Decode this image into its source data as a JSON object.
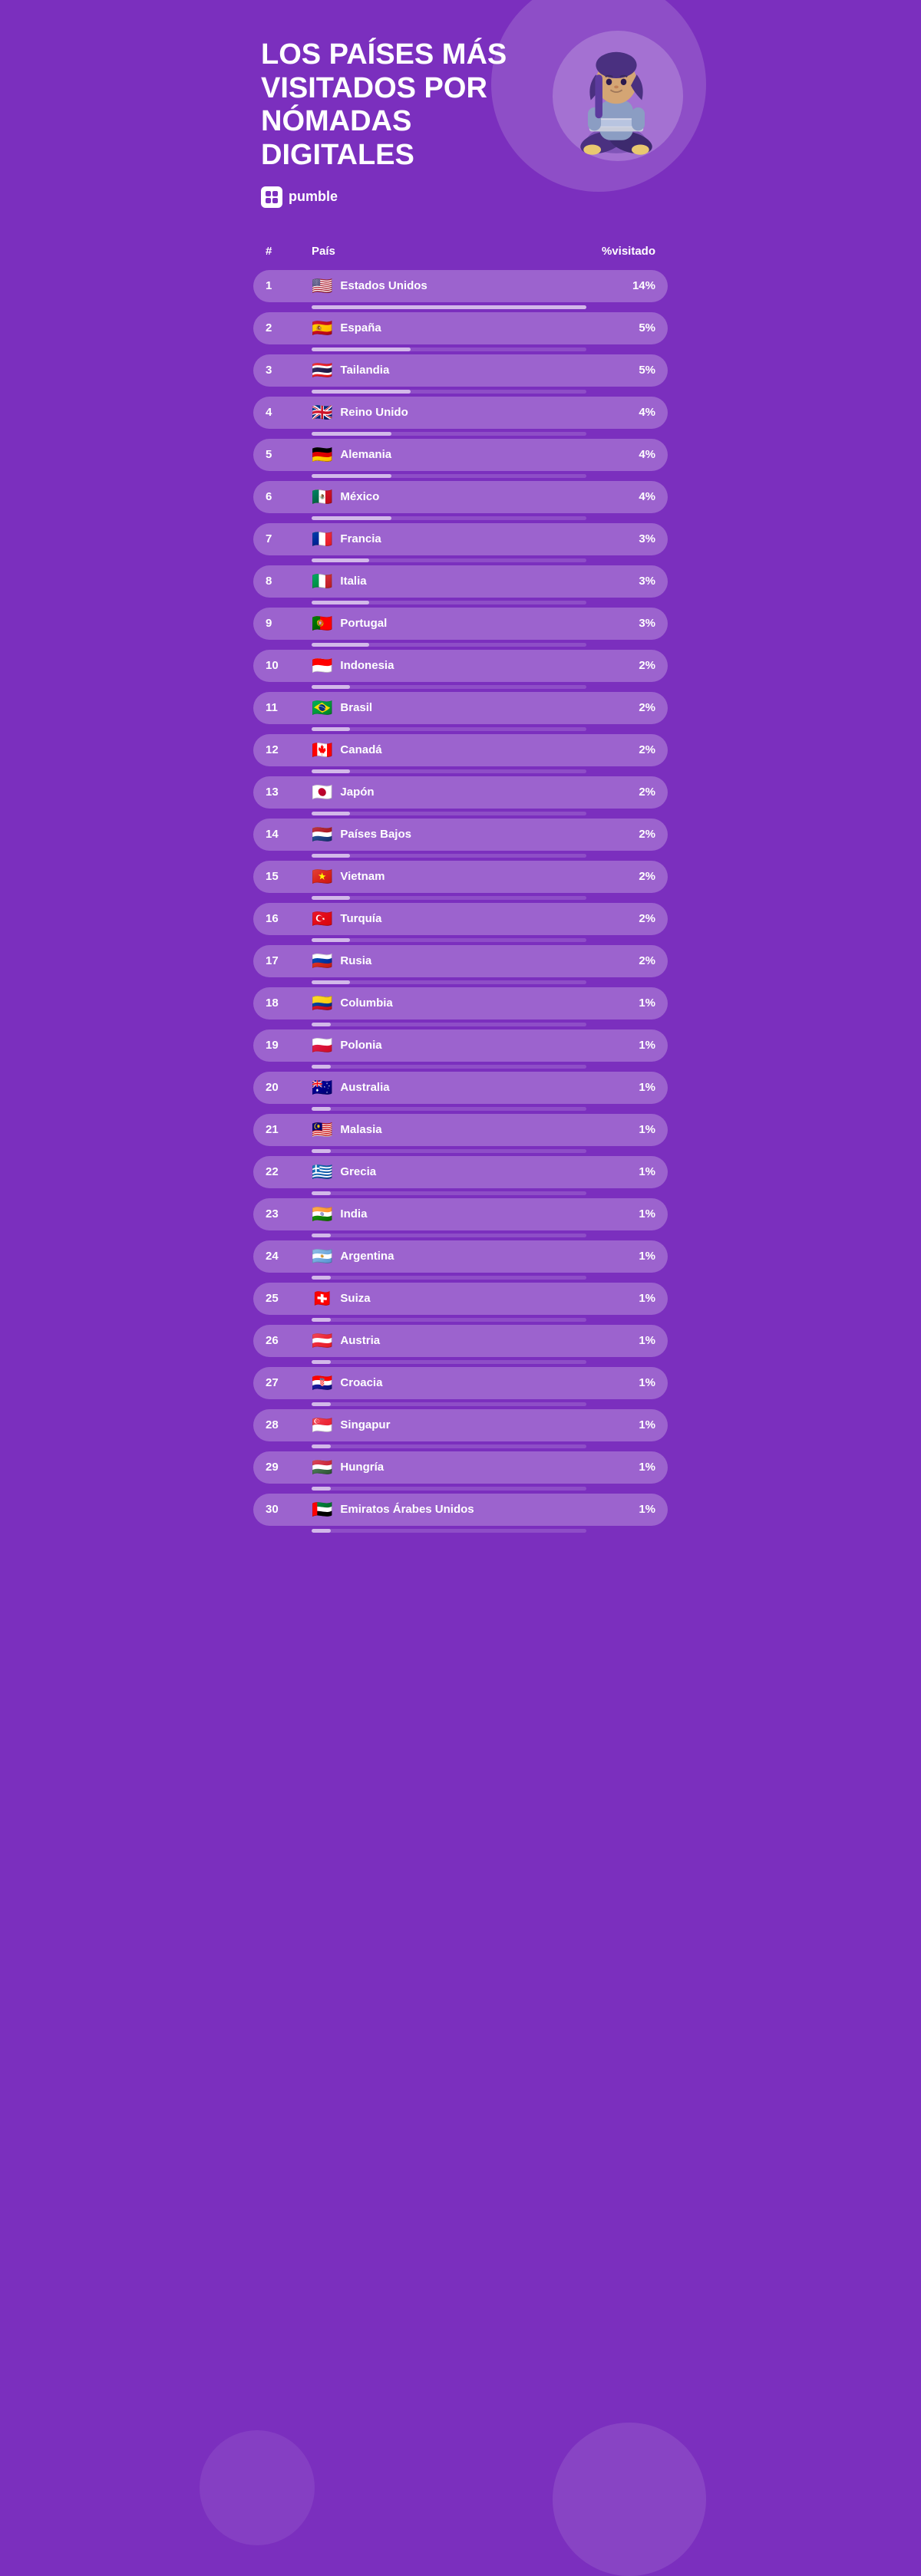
{
  "header": {
    "title": "LOS PAÍSES MÁS VISITADOS POR NÓMADAS DIGITALES",
    "logo_text": "pumble",
    "logo_icon": "🔲"
  },
  "table": {
    "columns": [
      "#",
      "País",
      "%visitado"
    ],
    "rows": [
      {
        "rank": "1",
        "country": "Estados Unidos",
        "flag": "🇺🇸",
        "percent": "14%",
        "bar": 100
      },
      {
        "rank": "2",
        "country": "España",
        "flag": "🇪🇸",
        "percent": "5%",
        "bar": 36
      },
      {
        "rank": "3",
        "country": "Tailandia",
        "flag": "🇹🇭",
        "percent": "5%",
        "bar": 36
      },
      {
        "rank": "4",
        "country": "Reino Unido",
        "flag": "🇬🇧",
        "percent": "4%",
        "bar": 29
      },
      {
        "rank": "5",
        "country": "Alemania",
        "flag": "🇩🇪",
        "percent": "4%",
        "bar": 29
      },
      {
        "rank": "6",
        "country": "México",
        "flag": "🇲🇽",
        "percent": "4%",
        "bar": 29
      },
      {
        "rank": "7",
        "country": "Francia",
        "flag": "🇫🇷",
        "percent": "3%",
        "bar": 21
      },
      {
        "rank": "8",
        "country": "Italia",
        "flag": "🇮🇹",
        "percent": "3%",
        "bar": 21
      },
      {
        "rank": "9",
        "country": "Portugal",
        "flag": "🇵🇹",
        "percent": "3%",
        "bar": 21
      },
      {
        "rank": "10",
        "country": "Indonesia",
        "flag": "🇮🇩",
        "percent": "2%",
        "bar": 14
      },
      {
        "rank": "11",
        "country": "Brasil",
        "flag": "🇧🇷",
        "percent": "2%",
        "bar": 14
      },
      {
        "rank": "12",
        "country": "Canadá",
        "flag": "🇨🇦",
        "percent": "2%",
        "bar": 14
      },
      {
        "rank": "13",
        "country": "Japón",
        "flag": "🇯🇵",
        "percent": "2%",
        "bar": 14
      },
      {
        "rank": "14",
        "country": "Países Bajos",
        "flag": "🇳🇱",
        "percent": "2%",
        "bar": 14
      },
      {
        "rank": "15",
        "country": "Vietnam",
        "flag": "🇻🇳",
        "percent": "2%",
        "bar": 14
      },
      {
        "rank": "16",
        "country": "Turquía",
        "flag": "🇹🇷",
        "percent": "2%",
        "bar": 14
      },
      {
        "rank": "17",
        "country": "Rusia",
        "flag": "🇷🇺",
        "percent": "2%",
        "bar": 14
      },
      {
        "rank": "18",
        "country": "Columbia",
        "flag": "🇨🇴",
        "percent": "1%",
        "bar": 7
      },
      {
        "rank": "19",
        "country": "Polonia",
        "flag": "🇵🇱",
        "percent": "1%",
        "bar": 7
      },
      {
        "rank": "20",
        "country": "Australia",
        "flag": "🇦🇺",
        "percent": "1%",
        "bar": 7
      },
      {
        "rank": "21",
        "country": "Malasia",
        "flag": "🇲🇾",
        "percent": "1%",
        "bar": 7
      },
      {
        "rank": "22",
        "country": "Grecia",
        "flag": "🇬🇷",
        "percent": "1%",
        "bar": 7
      },
      {
        "rank": "23",
        "country": "India",
        "flag": "🇮🇳",
        "percent": "1%",
        "bar": 7
      },
      {
        "rank": "24",
        "country": "Argentina",
        "flag": "🇦🇷",
        "percent": "1%",
        "bar": 7
      },
      {
        "rank": "25",
        "country": "Suiza",
        "flag": "🇨🇭",
        "percent": "1%",
        "bar": 7
      },
      {
        "rank": "26",
        "country": "Austria",
        "flag": "🇦🇹",
        "percent": "1%",
        "bar": 7
      },
      {
        "rank": "27",
        "country": "Croacia",
        "flag": "🇭🇷",
        "percent": "1%",
        "bar": 7
      },
      {
        "rank": "28",
        "country": "Singapur",
        "flag": "🇸🇬",
        "percent": "1%",
        "bar": 7
      },
      {
        "rank": "29",
        "country": "Hungría",
        "flag": "🇭🇺",
        "percent": "1%",
        "bar": 7
      },
      {
        "rank": "30",
        "country": "Emiratos Árabes Unidos",
        "flag": "🇦🇪",
        "percent": "1%",
        "bar": 7
      }
    ]
  }
}
